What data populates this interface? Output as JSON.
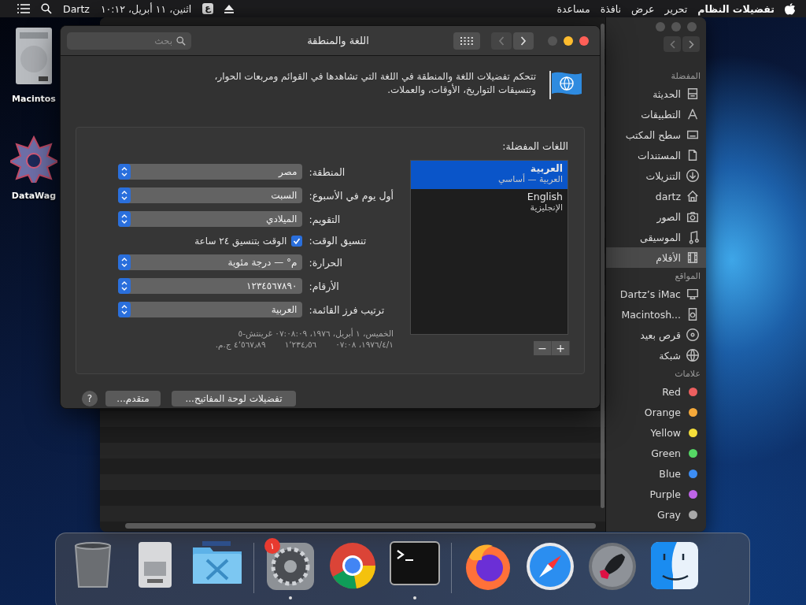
{
  "menu_bar": {
    "app_name": "تفضيلات النظام",
    "menus": [
      "تحرير",
      "عرض",
      "نافذة",
      "مساعدة"
    ],
    "input_source": "ع",
    "clock": "اثنين، ١١ أبريل، ١٠:١٢",
    "user": "Dartz"
  },
  "desktop_icons": [
    {
      "label": "Macintos",
      "kind": "drive"
    },
    {
      "label": "DataWag",
      "kind": "star"
    }
  ],
  "finder": {
    "sidebar": [
      {
        "title": "المفضلة",
        "items": [
          {
            "label": "الحديثة",
            "kind": "recents",
            "selected": false
          },
          {
            "label": "التطبيقات",
            "kind": "apps",
            "selected": false
          },
          {
            "label": "سطح المكتب",
            "kind": "desktop",
            "selected": false
          },
          {
            "label": "المستندات",
            "kind": "documents",
            "selected": false
          },
          {
            "label": "التنزيلات",
            "kind": "downloads",
            "selected": false
          },
          {
            "label": "dartz",
            "kind": "home",
            "selected": false
          },
          {
            "label": "الصور",
            "kind": "photos",
            "selected": false
          },
          {
            "label": "الموسيقى",
            "kind": "music",
            "selected": false
          },
          {
            "label": "الأفلام",
            "kind": "movies",
            "selected": true
          }
        ]
      },
      {
        "title": "المواقع",
        "items": [
          {
            "label": "Dartz’s iMac",
            "kind": "computer",
            "selected": false
          },
          {
            "label": "Macintosh...",
            "kind": "disk",
            "selected": false
          },
          {
            "label": "قرص بعيد",
            "kind": "optical",
            "selected": false
          },
          {
            "label": "شبكة",
            "kind": "network",
            "selected": false
          }
        ]
      },
      {
        "title": "علامات",
        "items": [
          {
            "label": "Red",
            "color": "#ec5f5f",
            "selected": false
          },
          {
            "label": "Orange",
            "color": "#f5a93a",
            "selected": false
          },
          {
            "label": "Yellow",
            "color": "#f5de3a",
            "selected": false
          },
          {
            "label": "Green",
            "color": "#55d865",
            "selected": false
          },
          {
            "label": "Blue",
            "color": "#3d8ef5",
            "selected": false
          },
          {
            "label": "Purple",
            "color": "#c065e8",
            "selected": false
          },
          {
            "label": "Gray",
            "color": "#a8a8a8",
            "selected": false
          }
        ]
      }
    ]
  },
  "prefs": {
    "title": "اللغة والمنطقة",
    "search": {
      "placeholder": "بحث"
    },
    "nav": {
      "back_enabled": false,
      "forward_enabled": true
    },
    "description": "تتحكم تفضيلات اللغة والمنطقة في اللغة التي تشاهدها في القوائم ومربعات الحوار، وتنسيقات التواريخ، الأوقات، والعملات.",
    "languages_label": "اللغات المفضلة:",
    "languages": [
      {
        "name": "العربية",
        "detail": "العربية — أساسي",
        "selected": true
      },
      {
        "name": "English",
        "detail": "الإنجليزية",
        "selected": false
      }
    ],
    "list_buttons": [
      "+",
      "−"
    ],
    "settings": [
      {
        "kind": "popup",
        "label": "المنطقة:",
        "value": "مصر"
      },
      {
        "kind": "popup",
        "label": "أول يوم في الأسبوع:",
        "value": "السبت"
      },
      {
        "kind": "popup",
        "label": "التقويم:",
        "value": "الميلادي"
      },
      {
        "kind": "checkbox",
        "label": "تنسيق الوقت:",
        "value": "الوقت بتنسيق ٢٤ ساعة",
        "checked": true
      },
      {
        "kind": "popup",
        "label": "الحرارة:",
        "value": "م° — درجة مئوية"
      },
      {
        "kind": "popup",
        "label": "الأرقام:",
        "value": "١٢٣٤٥٦٧٨٩٠"
      },
      {
        "kind": "popup",
        "label": "ترتيب فرز القائمة:",
        "value": "العربية"
      }
    ],
    "sample_lines": [
      [
        "الخميس، ١ أبريل، ١٩٧٦، ٠٧:٠٨:٠٩ غرينتش-٥"
      ],
      [
        "١٩٧٦/٤/١، ٠٧:٠٨",
        "١٬٢٣٤٫٥٦",
        "٤٬٥٦٧٫٨٩ ج.م."
      ]
    ],
    "help": "?",
    "buttons": [
      "تفضيلات لوحة المفاتيح...",
      "متقدم..."
    ]
  },
  "dock": [
    {
      "kind": "trash",
      "running": false
    },
    {
      "kind": "drive",
      "running": false
    },
    {
      "kind": "folder",
      "running": false
    },
    {
      "kind": "separator"
    },
    {
      "kind": "gear",
      "running": true,
      "badge": "١"
    },
    {
      "kind": "browser",
      "running": false
    },
    {
      "kind": "terminal",
      "running": true
    },
    {
      "kind": "separator"
    },
    {
      "kind": "fox",
      "running": false
    },
    {
      "kind": "compass",
      "running": false
    },
    {
      "kind": "rocket",
      "running": false
    },
    {
      "kind": "face",
      "running": false
    }
  ]
}
